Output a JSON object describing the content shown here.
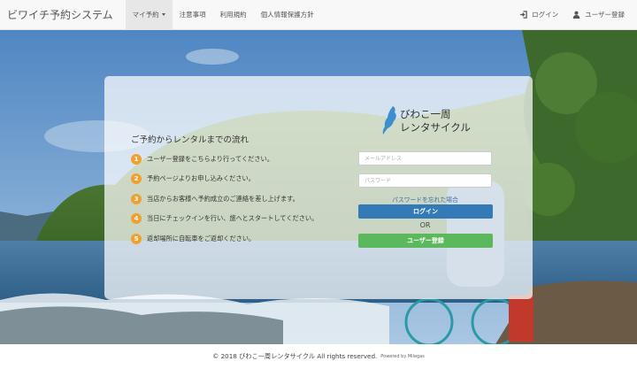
{
  "navbar": {
    "brand": "ビワイチ予約システム",
    "items": [
      {
        "label": "マイ予約",
        "dropdown": true
      },
      {
        "label": "注意事項"
      },
      {
        "label": "利用規約"
      },
      {
        "label": "個人情報保護方針"
      }
    ],
    "right": {
      "login": "ログイン",
      "register": "ユーザー登録"
    }
  },
  "flow": {
    "title": "ご予約からレンタルまでの流れ",
    "steps": [
      {
        "num": "1",
        "text": "ユーザー登録をこちらより行ってください。"
      },
      {
        "num": "2",
        "text": "予約ページよりお申し込みください。"
      },
      {
        "num": "3",
        "text": "当店からお客様へ予約成立のご連絡を差し上げます。"
      },
      {
        "num": "4",
        "text": "当日にチェックインを行い、旅へとスタートしてください。"
      },
      {
        "num": "5",
        "text": "返却場所に自転車をご返却ください。"
      }
    ]
  },
  "login_form": {
    "logo_line1": "びわこ一周",
    "logo_line2": "レンタサイクル",
    "email_placeholder": "メールアドレス",
    "password_placeholder": "パスワード",
    "forgot": "パスワードを忘れた場合",
    "login_button": "ログイン",
    "or": "OR",
    "register_button": "ユーザー登録"
  },
  "footer": {
    "copyright": "© 2018 びわこ一周レンタサイクル All rights reserved.",
    "powered": "Powered by Milegas"
  },
  "colors": {
    "step_badge": "#f0a030",
    "login_button": "#337ab7",
    "register_button": "#5cb85c",
    "link": "#3a6ea8"
  }
}
